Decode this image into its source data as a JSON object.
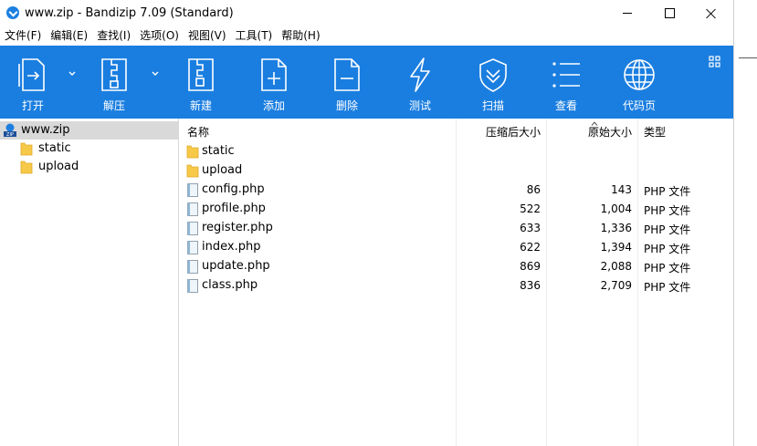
{
  "window": {
    "title": "www.zip - Bandizip 7.09 (Standard)"
  },
  "menu": [
    {
      "label": "文件(F)"
    },
    {
      "label": "编辑(E)"
    },
    {
      "label": "查找(I)"
    },
    {
      "label": "选项(O)"
    },
    {
      "label": "视图(V)"
    },
    {
      "label": "工具(T)"
    },
    {
      "label": "帮助(H)"
    }
  ],
  "toolbar": {
    "open": "打开",
    "extract": "解压",
    "new": "新建",
    "add": "添加",
    "delete": "删除",
    "test": "测试",
    "scan": "扫描",
    "view": "查看",
    "codepage": "代码页",
    "background_color": "#1a7ee0"
  },
  "tree": {
    "root": "www.zip",
    "children": [
      {
        "label": "static"
      },
      {
        "label": "upload"
      }
    ]
  },
  "filelist": {
    "columns": {
      "name": "名称",
      "compressed": "压缩后大小",
      "original": "原始大小",
      "type": "类型"
    },
    "rows": [
      {
        "name": "static",
        "compressed": "",
        "original": "",
        "type": "",
        "kind": "folder"
      },
      {
        "name": "upload",
        "compressed": "",
        "original": "",
        "type": "",
        "kind": "folder"
      },
      {
        "name": "config.php",
        "compressed": "86",
        "original": "143",
        "type": "PHP 文件",
        "kind": "file"
      },
      {
        "name": "profile.php",
        "compressed": "522",
        "original": "1,004",
        "type": "PHP 文件",
        "kind": "file"
      },
      {
        "name": "register.php",
        "compressed": "633",
        "original": "1,336",
        "type": "PHP 文件",
        "kind": "file"
      },
      {
        "name": "index.php",
        "compressed": "622",
        "original": "1,394",
        "type": "PHP 文件",
        "kind": "file"
      },
      {
        "name": "update.php",
        "compressed": "869",
        "original": "2,088",
        "type": "PHP 文件",
        "kind": "file"
      },
      {
        "name": "class.php",
        "compressed": "836",
        "original": "2,709",
        "type": "PHP 文件",
        "kind": "file"
      }
    ]
  }
}
